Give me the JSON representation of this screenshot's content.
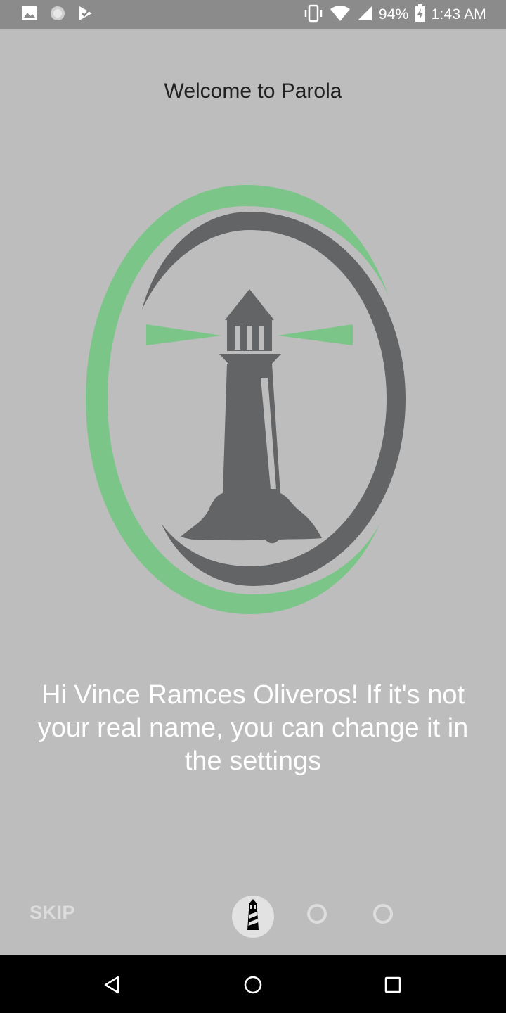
{
  "status_bar": {
    "battery": "94%",
    "time": "1:43 AM",
    "left_icons": [
      "image-icon",
      "spinner-icon",
      "play-check-icon"
    ],
    "right_icons": [
      "vibrate-icon",
      "wifi-icon",
      "signal-icon",
      "battery-icon"
    ]
  },
  "onboarding": {
    "title": "Welcome to Parola",
    "message": "Hi Vince Ramces Oliveros! If it's not your real name, you can change it in the settings",
    "skip_label": "SKIP",
    "page_indicator": {
      "total": 3,
      "current": 1
    }
  },
  "logo": {
    "icon": "lighthouse-logo",
    "colors": {
      "green": "#7bc589",
      "gray": "#636466"
    }
  },
  "navigation": {
    "buttons": [
      "back-icon",
      "home-icon",
      "recents-icon"
    ]
  },
  "colors": {
    "background": "#bdbdbd",
    "status_bar": "#8b8b8b",
    "nav_bar": "#000000",
    "title_text": "#212121",
    "message_text": "#ffffff"
  }
}
